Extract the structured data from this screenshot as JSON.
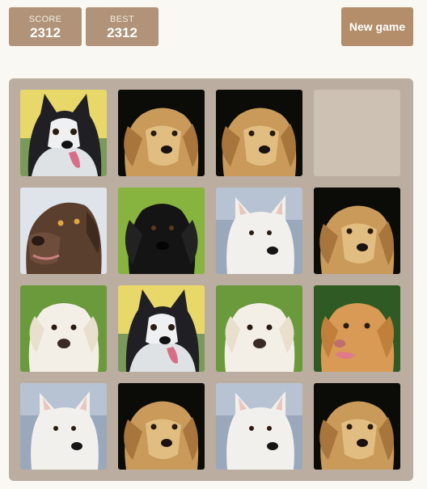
{
  "header": {
    "score_label": "SCORE",
    "score_value": "2312",
    "best_label": "BEST",
    "best_value": "2312",
    "new_game_label": "New game"
  },
  "board": {
    "rows": 4,
    "cols": 4,
    "tiles": [
      "husky",
      "golden-retriever",
      "golden-retriever",
      "empty",
      "chocolate-labrador",
      "black-retriever",
      "white-shepherd",
      "golden-retriever",
      "white-labrador",
      "husky",
      "white-labrador",
      "yellow-labrador",
      "white-shepherd",
      "golden-retriever",
      "white-shepherd",
      "golden-retriever"
    ]
  },
  "colors": {
    "background": "#faf8f2",
    "board": "#bbada0",
    "empty_cell": "#cdc1b4",
    "score_box": "#b09378",
    "button": "#b48e6b"
  }
}
